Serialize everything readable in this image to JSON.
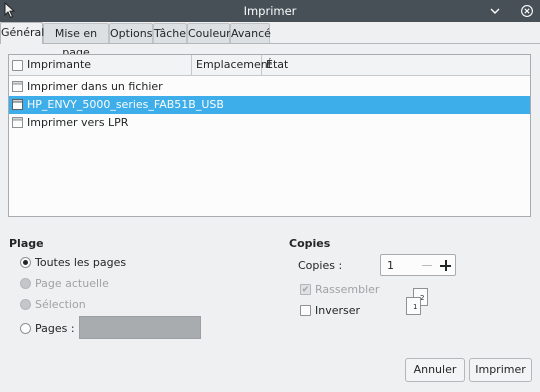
{
  "window": {
    "title": "Imprimer"
  },
  "tabs": [
    {
      "label": "Général",
      "active": true
    },
    {
      "label": "Mise en page",
      "active": false
    },
    {
      "label": "Options",
      "active": false
    },
    {
      "label": "Tâche",
      "active": false
    },
    {
      "label": "Couleur",
      "active": false
    },
    {
      "label": "Avancé",
      "active": false
    }
  ],
  "printer_list": {
    "columns": [
      "Imprimante",
      "Emplacement",
      "État"
    ],
    "rows": [
      {
        "name": "Imprimer dans un fichier",
        "location": "",
        "state": "",
        "selected": false
      },
      {
        "name": "HP_ENVY_5000_series_FAB51B_USB",
        "location": "",
        "state": "",
        "selected": true
      },
      {
        "name": "Imprimer vers LPR",
        "location": "",
        "state": "",
        "selected": false
      }
    ]
  },
  "range": {
    "title": "Plage",
    "options": [
      {
        "label": "Toutes les pages",
        "checked": true,
        "enabled": true
      },
      {
        "label": "Page actuelle",
        "checked": false,
        "enabled": false
      },
      {
        "label": "Sélection",
        "checked": false,
        "enabled": false
      },
      {
        "label": "Pages :",
        "checked": false,
        "enabled": true
      }
    ],
    "pages_value": ""
  },
  "copies": {
    "title": "Copies",
    "copies_label": "Copies :",
    "copies_value": "1",
    "collate_label": "Rassembler",
    "collate_checked": true,
    "collate_enabled": false,
    "reverse_label": "Inverser",
    "reverse_checked": false
  },
  "buttons": {
    "cancel": "Annuler",
    "print": "Imprimer"
  },
  "colors": {
    "selection": "#3daee9",
    "titlebar": "#475057"
  }
}
